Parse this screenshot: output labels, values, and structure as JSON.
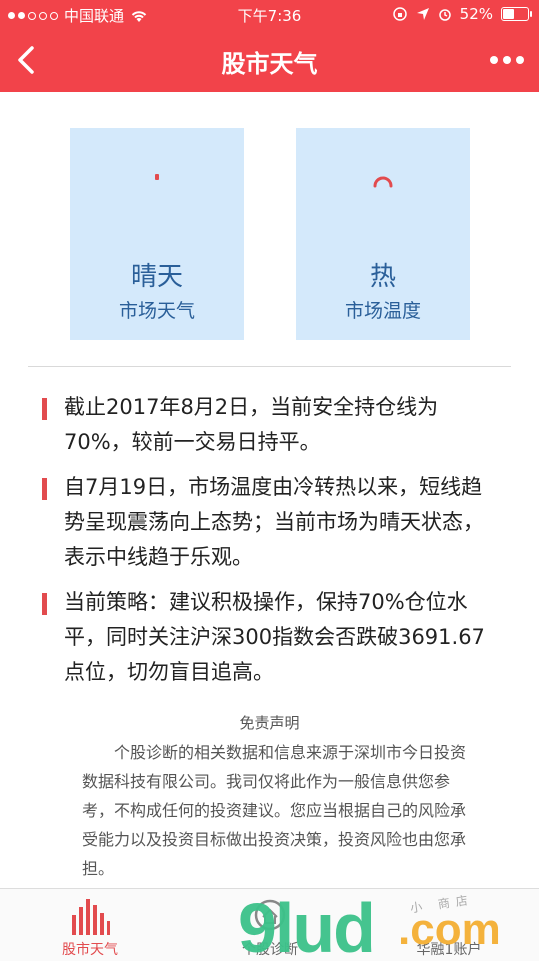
{
  "status_bar": {
    "carrier": "中国联通",
    "time": "下午7:36",
    "battery": "52%",
    "battery_level": 0.52
  },
  "header": {
    "title": "股市天气"
  },
  "cards": [
    {
      "main": "晴天",
      "sub": "市场天气"
    },
    {
      "main": "热",
      "sub": "市场温度"
    }
  ],
  "paragraphs": [
    "截止2017年8月2日，当前安全持仓线为70%，较前一交易日持平。",
    "自7月19日，市场温度由冷转热以来，短线趋势呈现震荡向上态势；当前市场为晴天状态，表示中线趋于乐观。",
    "当前策略：建议积极操作，保持70%仓位水平，同时关注沪深300指数会否跌破3691.67点位，切勿盲目追高。"
  ],
  "disclaimer": {
    "title": "免责声明",
    "body": "个股诊断的相关数据和信息来源于深圳市今日投资数据科技有限公司。我司仅将此作为一般信息供您参考，不构成任何的投资建议。您应当根据自己的风险承受能力以及投资目标做出投资决策，投资风险也由您承担。"
  },
  "tabs": [
    {
      "label": "股市天气",
      "active": true
    },
    {
      "label": "个股诊断",
      "active": false
    },
    {
      "label": "华融1账户",
      "active": false
    }
  ],
  "watermark": {
    "text": "9lud",
    "suffix": ".com",
    "store": "小 商店"
  },
  "colors": {
    "header_red": "#f2434a",
    "card_blue": "#d4e9fb",
    "label_blue": "#2a5f99",
    "accent_red": "#e24b4e"
  }
}
